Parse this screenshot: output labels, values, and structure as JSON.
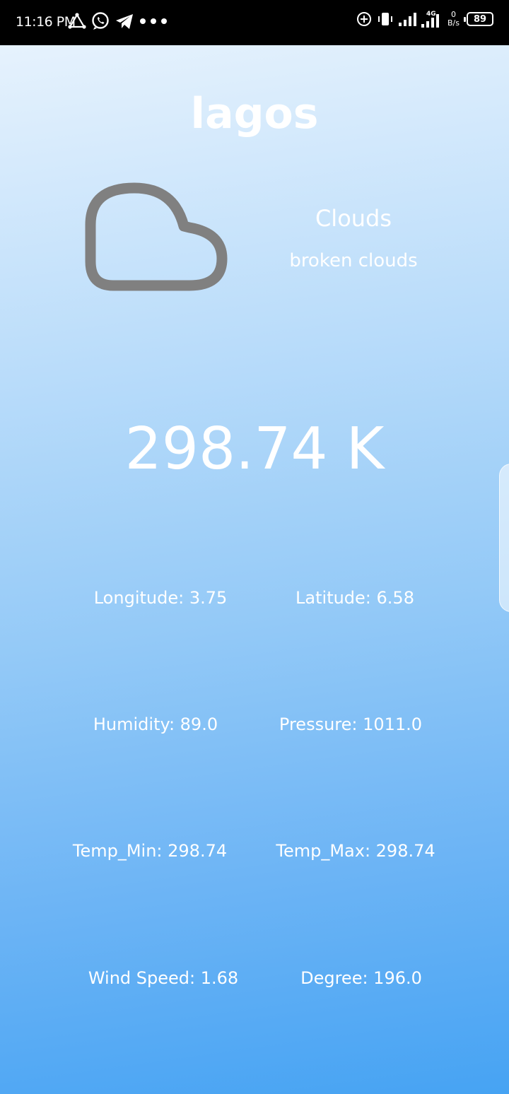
{
  "status_bar": {
    "time": "11:16 PM",
    "network_speed_value": "0",
    "network_speed_unit": "B/s",
    "battery": "89",
    "network_type": "4G"
  },
  "weather": {
    "city": "lagos",
    "icon": "cloud-icon",
    "main": "Clouds",
    "description": "broken clouds",
    "temperature": "298.74 K"
  },
  "stats": {
    "longitude": "Longitude: 3.75",
    "latitude": "Latitude: 6.58",
    "humidity": "Humidity: 89.0",
    "pressure": "Pressure: 1011.0",
    "temp_min": "Temp_Min: 298.74",
    "temp_max": "Temp_Max: 298.74",
    "wind_speed": "Wind Speed: 1.68",
    "degree": "Degree: 196.0"
  },
  "colors": {
    "gradient_top": "#e6f2fd",
    "gradient_bottom": "#46a3f3",
    "icon_stroke": "#808080",
    "text": "#ffffff"
  }
}
